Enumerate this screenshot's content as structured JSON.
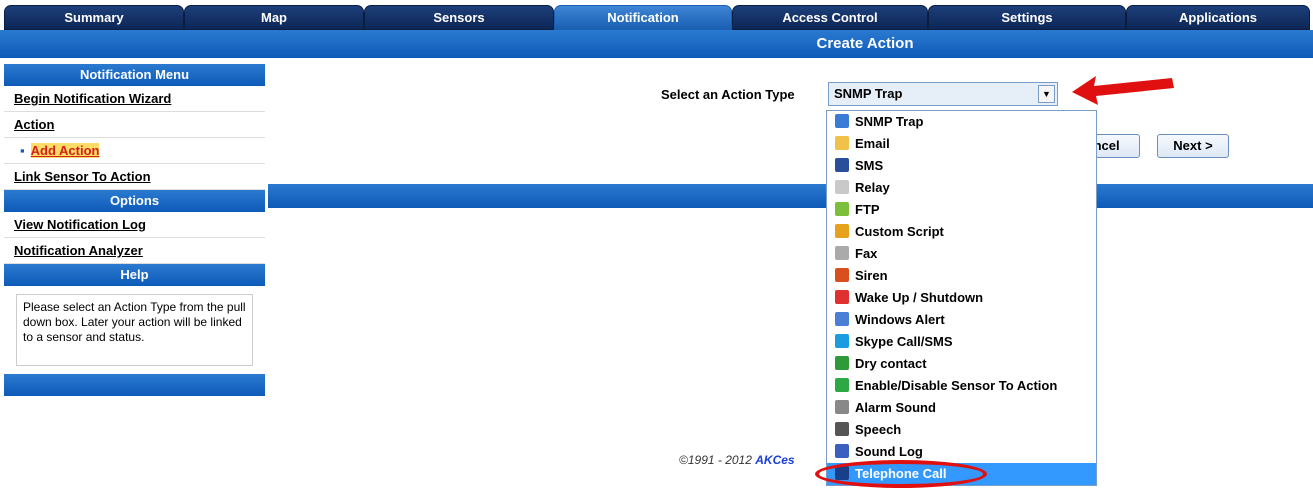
{
  "tabs": [
    {
      "label": "Summary"
    },
    {
      "label": "Map"
    },
    {
      "label": "Sensors"
    },
    {
      "label": "Notification"
    },
    {
      "label": "Access Control"
    },
    {
      "label": "Settings"
    },
    {
      "label": "Applications"
    }
  ],
  "page_title": "Create Action",
  "sidebar": {
    "notification_menu_title": "Notification Menu",
    "begin_wizard": "Begin Notification Wizard",
    "action": "Action",
    "add_action": "Add Action",
    "link_sensor": "Link Sensor To Action",
    "options_title": "Options",
    "view_log": "View Notification Log",
    "analyzer": "Notification Analyzer",
    "help_title": "Help",
    "help_text": "Please select an Action Type from the pull down box. Later your action will be linked to a sensor and status."
  },
  "form": {
    "select_label": "Select an Action Type",
    "selected_value": "SNMP Trap",
    "cancel_label": "ancel",
    "next_label": "Next >"
  },
  "dropdown_options": [
    {
      "label": "SNMP Trap",
      "icon": "network-icon",
      "color": "#3a7bd5"
    },
    {
      "label": "Email",
      "icon": "envelope-icon",
      "color": "#f0c24a"
    },
    {
      "label": "SMS",
      "icon": "phone-icon",
      "color": "#2a4f9a"
    },
    {
      "label": "Relay",
      "icon": "relay-icon",
      "color": "#c9c9c9"
    },
    {
      "label": "FTP",
      "icon": "ftp-icon",
      "color": "#7bbf3a"
    },
    {
      "label": "Custom Script",
      "icon": "pen-icon",
      "color": "#e5a21a"
    },
    {
      "label": "Fax",
      "icon": "fax-icon",
      "color": "#aaaaaa"
    },
    {
      "label": "Siren",
      "icon": "siren-icon",
      "color": "#d9501e"
    },
    {
      "label": "Wake Up / Shutdown",
      "icon": "power-icon",
      "color": "#e03030"
    },
    {
      "label": "Windows Alert",
      "icon": "windows-icon",
      "color": "#4a7fd6"
    },
    {
      "label": "Skype Call/SMS",
      "icon": "skype-icon",
      "color": "#1a9de0"
    },
    {
      "label": "Dry contact",
      "icon": "contact-icon",
      "color": "#2e9a3a"
    },
    {
      "label": "Enable/Disable Sensor To Action",
      "icon": "toggle-icon",
      "color": "#2ea845"
    },
    {
      "label": "Alarm Sound",
      "icon": "speaker-icon",
      "color": "#888888"
    },
    {
      "label": "Speech",
      "icon": "speech-icon",
      "color": "#555555"
    },
    {
      "label": "Sound Log",
      "icon": "microphone-icon",
      "color": "#3a5fbf"
    },
    {
      "label": "Telephone Call",
      "icon": "telephone-icon",
      "color": "#1a3f8a"
    }
  ],
  "selected_index": 16,
  "footer": {
    "prefix": "©1991 - 2012 ",
    "link": "AKCes"
  },
  "colors": {
    "tab_active": "#3f86d6",
    "bar": "#0d5ab8",
    "highlight": "#3399ff",
    "annotation": "#e01010"
  }
}
